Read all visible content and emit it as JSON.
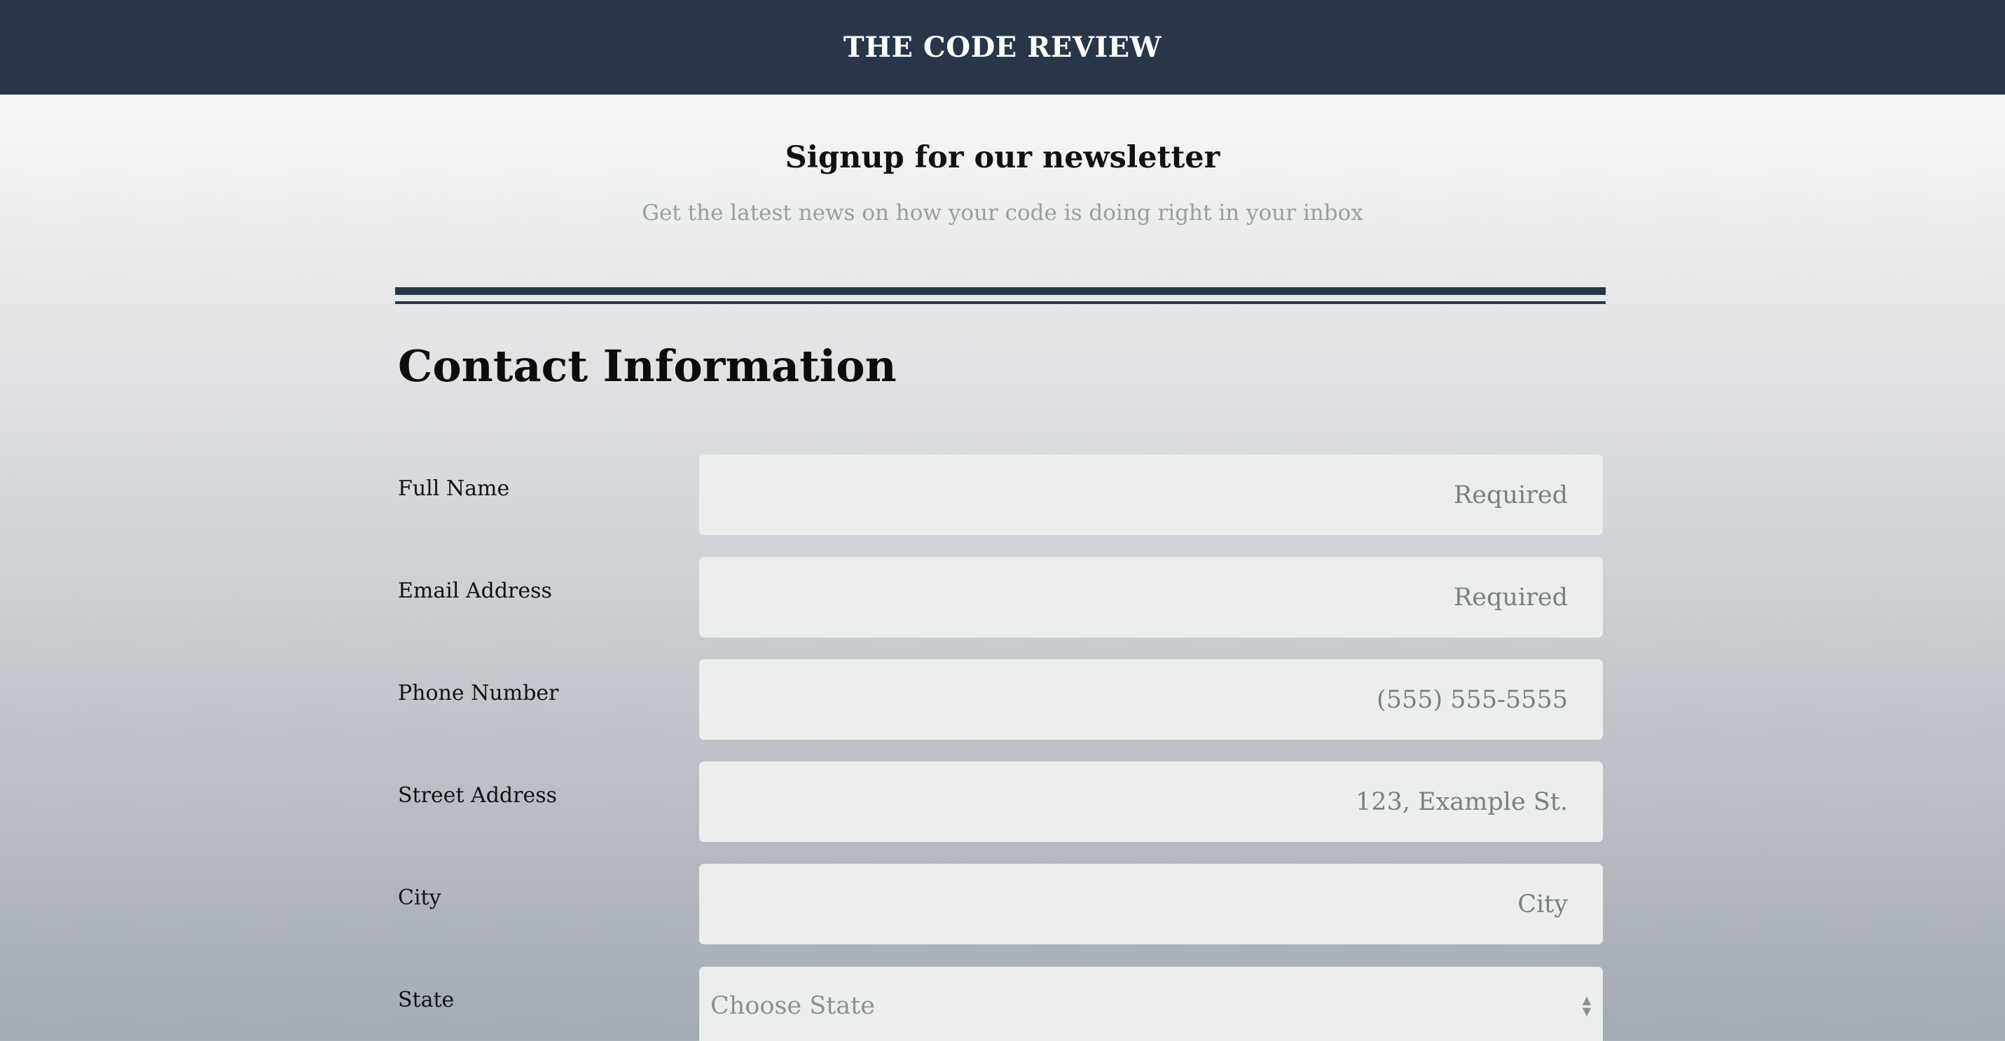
{
  "header": {
    "brand": "THE CODE REVIEW"
  },
  "hero": {
    "title": "Signup for our newsletter",
    "subtitle": "Get the latest news on how your code is doing right in your inbox"
  },
  "form": {
    "section_title": "Contact Information",
    "fields": [
      {
        "label": "Full Name",
        "placeholder": "Required",
        "value": ""
      },
      {
        "label": "Email Address",
        "placeholder": "Required",
        "value": ""
      },
      {
        "label": "Phone Number",
        "placeholder": "(555) 555-5555",
        "value": ""
      },
      {
        "label": "Street Address",
        "placeholder": "123, Example St.",
        "value": ""
      },
      {
        "label": "City",
        "placeholder": "City",
        "value": ""
      }
    ],
    "state": {
      "label": "State",
      "selected": "Choose State",
      "arrow_icon": "up-down-arrows-icon"
    }
  },
  "colors": {
    "header_bg": "#283648",
    "input_bg": "#eceeed",
    "placeholder": "#7b7e80",
    "subtitle": "#9a9d9f"
  }
}
